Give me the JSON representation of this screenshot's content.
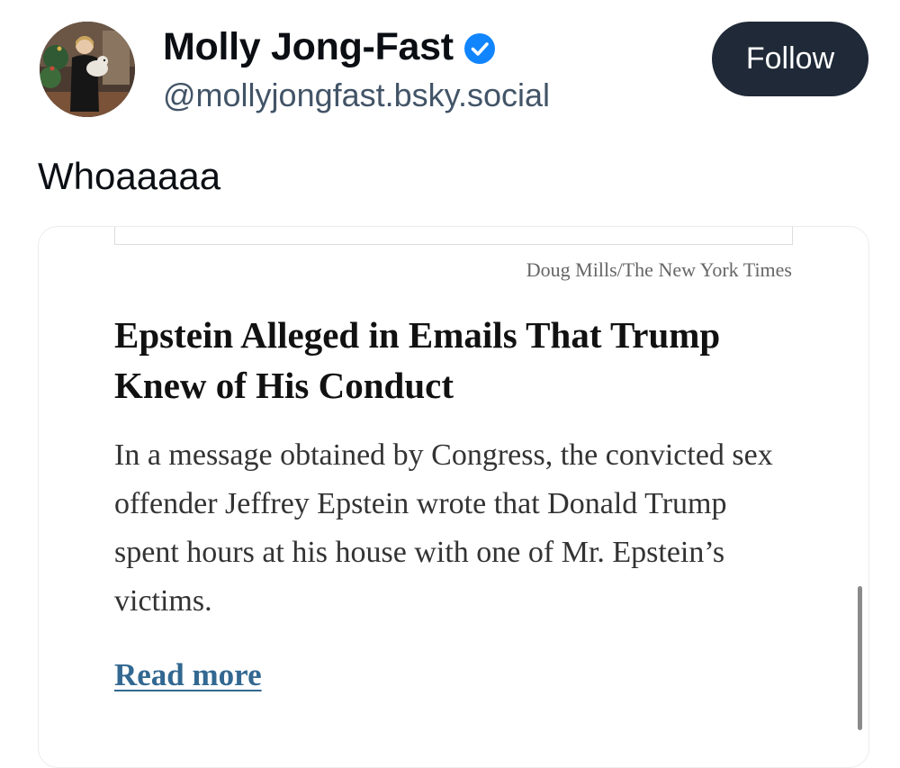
{
  "author": {
    "display_name": "Molly Jong-Fast",
    "handle": "@mollyjongfast.bsky.social",
    "verified": true,
    "avatar_icon": "profile-photo"
  },
  "follow_button": {
    "label": "Follow"
  },
  "post": {
    "text": "Whoaaaaa"
  },
  "link_card": {
    "photo_credit": "Doug Mills/The New York Times",
    "headline": "Epstein Alleged in Emails That Trump Knew of His Conduct",
    "summary": "In a message obtained by Congress, the convicted sex offender Jeffrey Epstein wrote that Donald Trump spent hours at his house with one of Mr. Epstein’s victims.",
    "read_more": "Read more"
  },
  "colors": {
    "follow_bg": "#1f2937",
    "verified_blue": "#1185fe",
    "handle_gray": "#425467",
    "link_blue": "#326891"
  }
}
